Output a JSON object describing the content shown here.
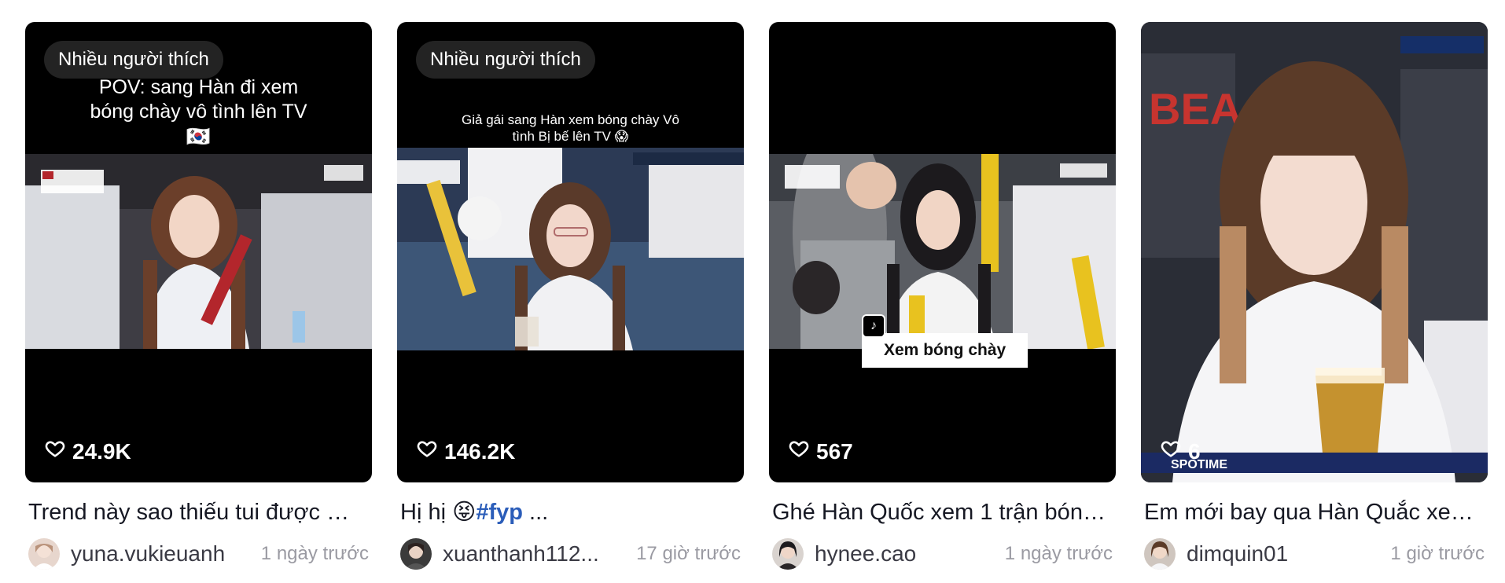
{
  "cards": [
    {
      "badge": "Nhiều người thích",
      "overlay_caption": "POV: sang Hàn đi xem bóng chày vô tình lên TV 🇰🇷",
      "likes": "24.9K",
      "description": "Trend này sao thiếu tui được 😆 ...",
      "username": "yuna.vukieuanh",
      "time": "1 ngày trước",
      "colors": {
        "scene": "#3b3a3f",
        "jersey": "#eef0f4",
        "hair": "#6b3f2a",
        "accent": "#b3262c"
      }
    },
    {
      "badge": "Nhiều người thích",
      "overlay_caption": "Giả gái sang Hàn xem bóng chày Vô tình Bị bế lên TV 😱",
      "likes": "146.2K",
      "description_text": "Hị hị 😝",
      "description_tag": "#fyp",
      "description_suffix": " ...",
      "username": "xuanthanh112...",
      "time": "17 giờ trước",
      "colors": {
        "scene": "#2c3a55",
        "jersey": "#f1f1f3",
        "hair": "#5a3a2a",
        "accent": "#e9c23a"
      }
    },
    {
      "badge": "",
      "overlay_label": "Xem bóng chày",
      "likes": "567",
      "description": "Ghé Hàn Quốc xem 1 trận bóng ...",
      "username": "hynee.cao",
      "time": "1 ngày trước",
      "colors": {
        "scene": "#5a5d63",
        "jersey": "#f3f3f3",
        "hair": "#1c1a1d",
        "accent": "#e8c21f"
      }
    },
    {
      "badge": "",
      "likes": "6",
      "description": "Em mới bay qua Hàn Quắc xem ...",
      "username": "dimquin01",
      "time": "1 giờ trước",
      "colors": {
        "scene": "#2a2d36",
        "jersey": "#f5f5f7",
        "hair": "#5b3b28",
        "accent": "#c5922f"
      }
    }
  ]
}
